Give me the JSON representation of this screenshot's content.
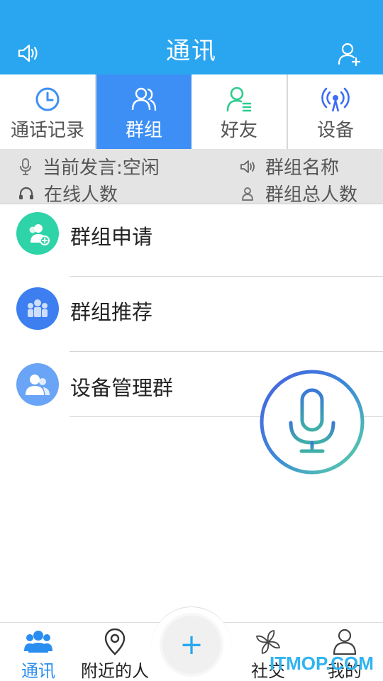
{
  "header": {
    "title": "通讯",
    "left_icon": "speaker-icon",
    "right_icon": "add-user-icon",
    "bg_color": "#2aa6f0"
  },
  "tabs": [
    {
      "label": "通话记录",
      "icon": "clock-icon",
      "color": "#3d8ff6",
      "active": false
    },
    {
      "label": "群组",
      "icon": "group-icon",
      "color": "#ffffff",
      "active": true
    },
    {
      "label": "好友",
      "icon": "friend-icon",
      "color": "#2ecc8e",
      "active": false
    },
    {
      "label": "设备",
      "icon": "device-signal-icon",
      "color": "#3d6df6",
      "active": false
    }
  ],
  "infobar": {
    "current_speech": "当前发言:空闲",
    "online_count": "在线人数",
    "group_name": "群组名称",
    "group_total": "群组总人数"
  },
  "list": [
    {
      "name": "群组申请",
      "icon": "group-apply-icon",
      "color": "#2ed3a8"
    },
    {
      "name": "群组推荐",
      "icon": "group-recommend-icon",
      "color": "#3d7ef0"
    },
    {
      "name": "设备管理群",
      "icon": "device-group-icon",
      "color": "#6aa4f6"
    }
  ],
  "mic_button": {
    "icon": "microphone-icon"
  },
  "bottom_nav": {
    "items": [
      {
        "label": "通讯",
        "icon": "contacts-icon",
        "active": true
      },
      {
        "label": "附近的人",
        "icon": "location-pin-icon",
        "active": false
      },
      {
        "label": "社交",
        "icon": "pinwheel-icon",
        "active": false
      },
      {
        "label": "我的",
        "icon": "person-icon",
        "active": false
      }
    ],
    "fab_label": "+"
  },
  "watermark": "ITMOP.COM"
}
